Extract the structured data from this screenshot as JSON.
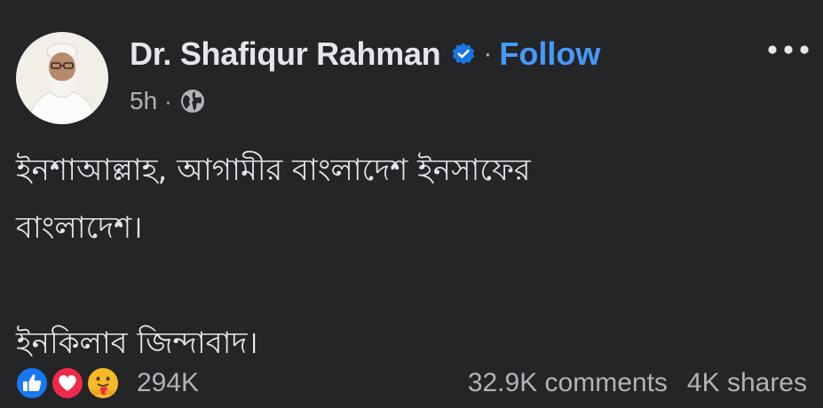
{
  "post": {
    "author": {
      "name": "Dr. Shafiqur Rahman",
      "verified": true,
      "follow_label": "Follow",
      "separator": "·"
    },
    "meta": {
      "time": "5h",
      "separator": "·",
      "audience_icon": "globe-icon"
    },
    "more_icon": "more-options-icon",
    "text_lines": [
      "ইনশাআল্লাহ, আগামীর বাংলাদেশ ইনসাফের",
      "বাংলাদেশ।",
      "",
      "ইনকিলাব জিন্দাবাদ।"
    ],
    "reactions": {
      "icons": [
        "like-icon",
        "love-icon",
        "care-icon"
      ],
      "count": "294K"
    },
    "stats": {
      "comments": "32.9K comments",
      "shares": "4K shares"
    }
  },
  "colors": {
    "background": "#242526",
    "text_primary": "#e4e6eb",
    "text_secondary": "#b0b3b8",
    "follow_blue": "#4599ff",
    "verified_blue": "#1b74e4",
    "like_blue": "#1877f2",
    "love_red": "#f02849",
    "care_yellow": "#f7b928"
  }
}
